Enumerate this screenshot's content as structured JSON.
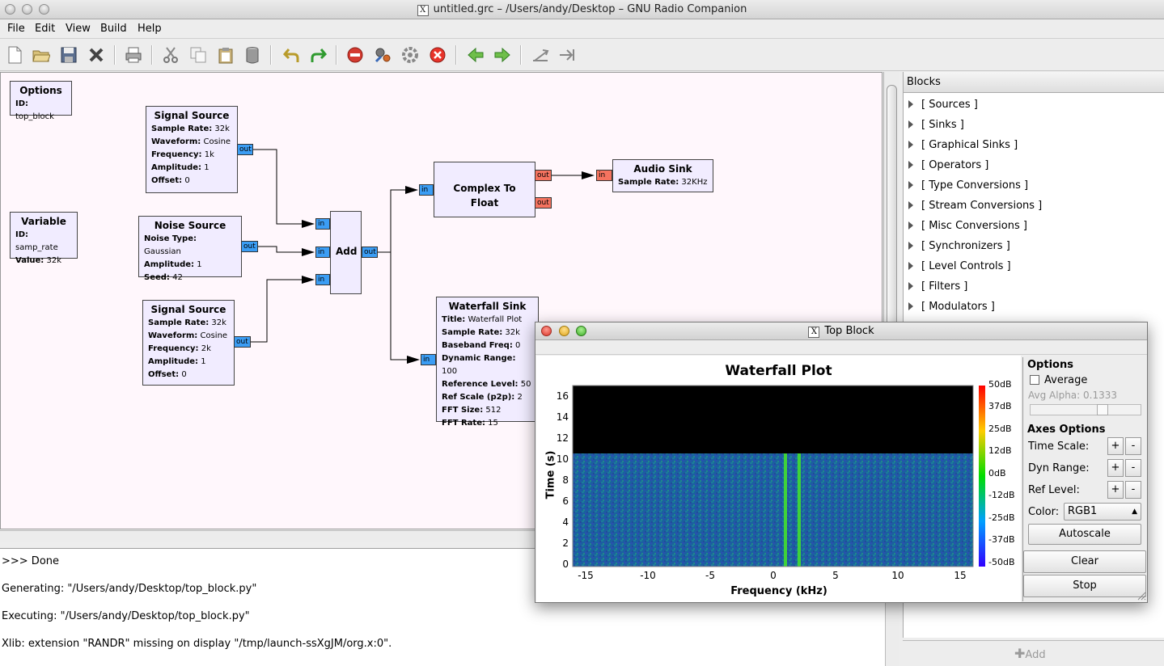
{
  "window": {
    "title": "untitled.grc – /Users/andy/Desktop – GNU Radio Companion"
  },
  "menu": [
    "File",
    "Edit",
    "View",
    "Build",
    "Help"
  ],
  "toolbar_icons": [
    "new-icon",
    "open-icon",
    "save-icon",
    "close-icon",
    "print-icon",
    "cut-icon",
    "copy-icon",
    "paste-icon",
    "delete-icon",
    "undo-icon",
    "redo-icon",
    "kill-icon",
    "generate-icon",
    "execute-icon",
    "stop-icon",
    "arrow-left-icon",
    "arrow-right-icon",
    "rotate-ccw-icon",
    "rotate-cw-icon"
  ],
  "blocks": {
    "options": {
      "name": "Options",
      "params": [
        {
          "k": "ID:",
          "v": "top_block"
        }
      ]
    },
    "variable": {
      "name": "Variable",
      "params": [
        {
          "k": "ID:",
          "v": "samp_rate"
        },
        {
          "k": "Value:",
          "v": "32k"
        }
      ]
    },
    "sig1": {
      "name": "Signal Source",
      "params": [
        {
          "k": "Sample Rate:",
          "v": "32k"
        },
        {
          "k": "Waveform:",
          "v": "Cosine"
        },
        {
          "k": "Frequency:",
          "v": "1k"
        },
        {
          "k": "Amplitude:",
          "v": "1"
        },
        {
          "k": "Offset:",
          "v": "0"
        }
      ]
    },
    "noise": {
      "name": "Noise Source",
      "params": [
        {
          "k": "Noise Type:",
          "v": "Gaussian"
        },
        {
          "k": "Amplitude:",
          "v": "1"
        },
        {
          "k": "Seed:",
          "v": "42"
        }
      ]
    },
    "sig2": {
      "name": "Signal Source",
      "params": [
        {
          "k": "Sample Rate:",
          "v": "32k"
        },
        {
          "k": "Waveform:",
          "v": "Cosine"
        },
        {
          "k": "Frequency:",
          "v": "2k"
        },
        {
          "k": "Amplitude:",
          "v": "1"
        },
        {
          "k": "Offset:",
          "v": "0"
        }
      ]
    },
    "add": {
      "name": "Add"
    },
    "c2f": {
      "name": "Complex To Float"
    },
    "audio": {
      "name": "Audio Sink",
      "params": [
        {
          "k": "Sample Rate:",
          "v": "32KHz"
        }
      ]
    },
    "waterfall": {
      "name": "Waterfall Sink",
      "params": [
        {
          "k": "Title:",
          "v": "Waterfall Plot"
        },
        {
          "k": "Sample Rate:",
          "v": "32k"
        },
        {
          "k": "Baseband Freq:",
          "v": "0"
        },
        {
          "k": "Dynamic Range:",
          "v": "100"
        },
        {
          "k": "Reference Level:",
          "v": "50"
        },
        {
          "k": "Ref Scale (p2p):",
          "v": "2"
        },
        {
          "k": "FFT Size:",
          "v": "512"
        },
        {
          "k": "FFT Rate:",
          "v": "15"
        }
      ]
    }
  },
  "ports": {
    "in": "in",
    "out": "out"
  },
  "console": [
    ">>> Done",
    "Generating: \"/Users/andy/Desktop/top_block.py\"",
    "Executing: \"/Users/andy/Desktop/top_block.py\"",
    "Xlib:  extension \"RANDR\" missing on display \"/tmp/launch-ssXgJM/org.x:0\"."
  ],
  "tree": {
    "header": "Blocks",
    "items": [
      "[ Sources ]",
      "[ Sinks ]",
      "[ Graphical Sinks ]",
      "[ Operators ]",
      "[ Type Conversions ]",
      "[ Stream Conversions ]",
      "[ Misc Conversions ]",
      "[ Synchronizers ]",
      "[ Level Controls ]",
      "[ Filters ]",
      "[ Modulators ]"
    ],
    "add_label": "Add"
  },
  "topblock": {
    "title": "Top Block",
    "plot_title": "Waterfall Plot",
    "ylabel": "Time (s)",
    "xlabel": "Frequency (kHz)",
    "yticks": [
      "16",
      "14",
      "12",
      "10",
      "8",
      "6",
      "4",
      "2",
      "0"
    ],
    "xticks": [
      "-15",
      "-10",
      "-5",
      "0",
      "5",
      "10",
      "15"
    ],
    "colorbar": [
      "50dB",
      "37dB",
      "25dB",
      "12dB",
      "0dB",
      "-12dB",
      "-25dB",
      "-37dB",
      "-50dB"
    ],
    "options": {
      "header": "Options",
      "average_label": "Average",
      "avg_alpha_label": "Avg Alpha: 0.1333",
      "axes_header": "Axes Options",
      "time_scale": "Time Scale:",
      "dyn_range": "Dyn Range:",
      "ref_level": "Ref Level:",
      "color_label": "Color:",
      "color_value": "RGB1",
      "plus": "+",
      "minus": "-",
      "autoscale": "Autoscale",
      "clear": "Clear",
      "stop": "Stop"
    }
  }
}
